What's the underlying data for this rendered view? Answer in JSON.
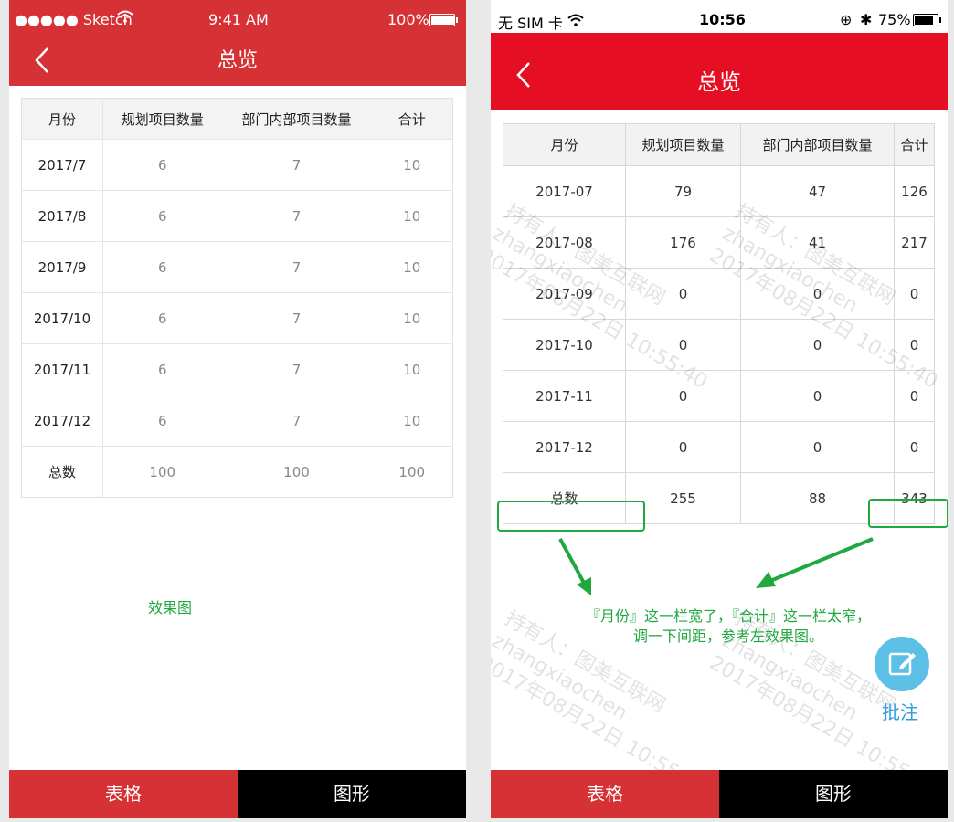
{
  "left": {
    "status": {
      "carrier": "●●●●● Sketch",
      "time": "9:41 AM",
      "battery": "100%",
      "battery_level": 1.0
    },
    "title": "总览",
    "table": {
      "headers": [
        "月份",
        "规划项目数量",
        "部门内部项目数量",
        "合计"
      ],
      "rows": [
        [
          "2017/7",
          "6",
          "7",
          "10"
        ],
        [
          "2017/8",
          "6",
          "7",
          "10"
        ],
        [
          "2017/9",
          "6",
          "7",
          "10"
        ],
        [
          "2017/10",
          "6",
          "7",
          "10"
        ],
        [
          "2017/11",
          "6",
          "7",
          "10"
        ],
        [
          "2017/12",
          "6",
          "7",
          "10"
        ],
        [
          "总数",
          "100",
          "100",
          "100"
        ]
      ]
    },
    "effect_label": "效果图",
    "tabs": {
      "table": "表格",
      "chart": "图形"
    }
  },
  "right": {
    "status": {
      "carrier": "无 SIM 卡",
      "time": "10:56",
      "battery": "75%",
      "battery_level": 0.75
    },
    "title": "总览",
    "table": {
      "headers": [
        "月份",
        "规划项目数量",
        "部门内部项目数量",
        "合计"
      ],
      "rows": [
        [
          "2017-07",
          "79",
          "47",
          "126"
        ],
        [
          "2017-08",
          "176",
          "41",
          "217"
        ],
        [
          "2017-09",
          "0",
          "0",
          "0"
        ],
        [
          "2017-10",
          "0",
          "0",
          "0"
        ],
        [
          "2017-11",
          "0",
          "0",
          "0"
        ],
        [
          "2017-12",
          "0",
          "0",
          "0"
        ],
        [
          "总数",
          "255",
          "88",
          "343"
        ]
      ]
    },
    "note": {
      "line1": "『月份』这一栏宽了，『合计』这一栏太窄，",
      "line2": "调一下间距，参考左效果图。"
    },
    "watermark": {
      "line1": "持有人：图美互联网",
      "line2": "zhangxiaochen",
      "line3": "2017年08月22日 10:55:40"
    },
    "annotate_label": "批注",
    "tabs": {
      "table": "表格",
      "chart": "图形"
    }
  },
  "colors": {
    "left_red": "#d63236",
    "right_red": "#e60e22",
    "annotation_green": "#1fa83e",
    "annotate_blue": "#5bbfe6"
  }
}
